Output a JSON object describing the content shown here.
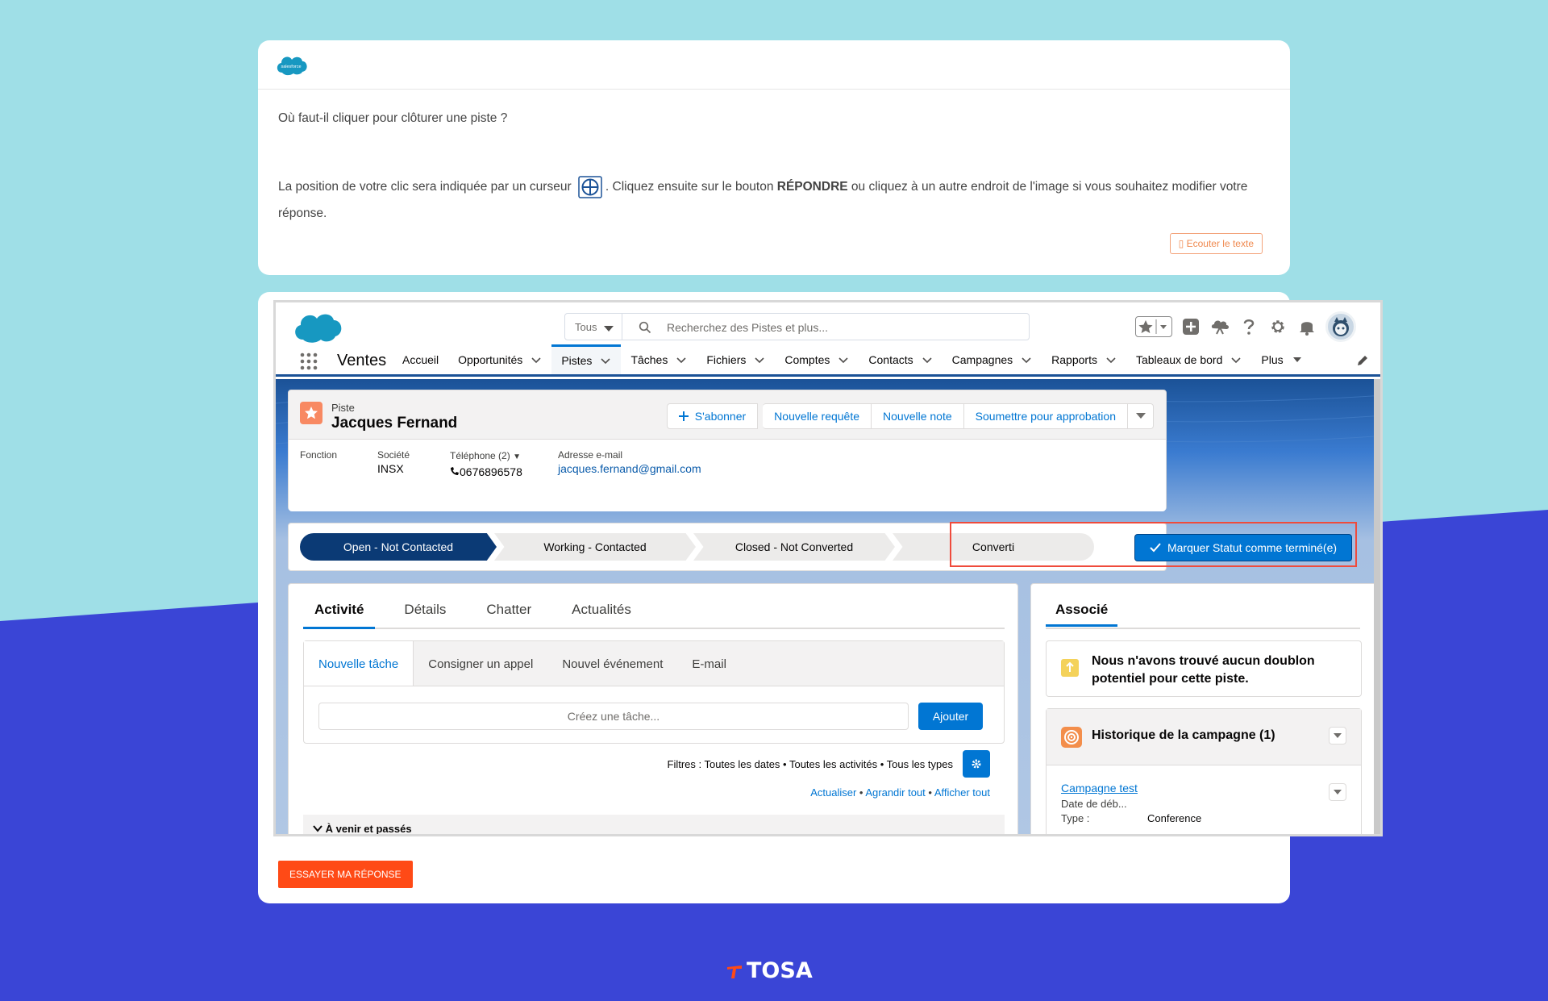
{
  "question": {
    "logo_text": "salesforce",
    "prompt": "Où faut-il cliquer pour clôturer une piste ?",
    "instruction_before": "La position de votre clic sera indiquée par un curseur",
    "instruction_mid": ". Cliquez ensuite sur le bouton ",
    "instruction_bold": "RÉPONDRE",
    "instruction_after": " ou cliquez à un autre endroit de l'image si vous souhaitez modifier votre réponse.",
    "listen_button": "Ecouter le texte"
  },
  "answer": {
    "try_button": "ESSAYER MA RÉPONSE"
  },
  "sf": {
    "search": {
      "scope": "Tous",
      "placeholder": "Recherchez des Pistes et plus..."
    },
    "app_name": "Ventes",
    "nav": [
      {
        "label": "Accueil",
        "has_menu": false,
        "active": false
      },
      {
        "label": "Opportunités",
        "has_menu": true,
        "active": false
      },
      {
        "label": "Pistes",
        "has_menu": true,
        "active": true
      },
      {
        "label": "Tâches",
        "has_menu": true,
        "active": false
      },
      {
        "label": "Fichiers",
        "has_menu": true,
        "active": false
      },
      {
        "label": "Comptes",
        "has_menu": true,
        "active": false
      },
      {
        "label": "Contacts",
        "has_menu": true,
        "active": false
      },
      {
        "label": "Campagnes",
        "has_menu": true,
        "active": false
      },
      {
        "label": "Rapports",
        "has_menu": true,
        "active": false
      },
      {
        "label": "Tableaux de bord",
        "has_menu": true,
        "active": false
      },
      {
        "label": "Plus",
        "has_menu": true,
        "active": false
      }
    ],
    "record": {
      "object_label": "Piste",
      "name": "Jacques Fernand",
      "actions": [
        "S'abonner",
        "Nouvelle requête",
        "Nouvelle note",
        "Soumettre pour approbation"
      ],
      "fields": {
        "fonction_label": "Fonction",
        "societe_label": "Société",
        "societe_value": "INSX",
        "telephone_label": "Téléphone (2)",
        "telephone_value": "0676896578",
        "email_label": "Adresse e-mail",
        "email_value": "jacques.fernand@gmail.com"
      }
    },
    "path": {
      "stages": [
        "Open - Not Contacted",
        "Working - Contacted",
        "Closed - Not Converted",
        "Converti"
      ],
      "current_index": 0,
      "mark_button": "Marquer Statut comme terminé(e)"
    },
    "activity": {
      "tabs": [
        "Activité",
        "Détails",
        "Chatter",
        "Actualités"
      ],
      "composer_tabs": [
        "Nouvelle tâche",
        "Consigner un appel",
        "Nouvel événement",
        "E-mail"
      ],
      "task_placeholder": "Créez une tâche...",
      "add_button": "Ajouter",
      "filters": "Filtres : Toutes les dates • Toutes les activités • Tous les types",
      "links": [
        "Actualiser",
        "Agrandir tout",
        "Afficher tout"
      ],
      "section": "À venir et passés"
    },
    "related": {
      "tab": "Associé",
      "duplicates": "Nous n'avons trouvé aucun doublon potentiel pour cette piste.",
      "campaign_title": "Historique de la campagne (1)",
      "campaign_link": "Campagne test",
      "campaign_date_label": "Date de déb...",
      "campaign_type_label": "Type :",
      "campaign_type_value": "Conference"
    }
  },
  "footer": {
    "brand": "TOSA"
  },
  "colors": {
    "teal_bg": "#9fdfe7",
    "indigo_bg": "#3a45d6",
    "sf_blue": "#0176d3",
    "path_active": "#0b3a75",
    "highlight_red": "#ef4b3c",
    "try_orange": "#ff4a16"
  }
}
